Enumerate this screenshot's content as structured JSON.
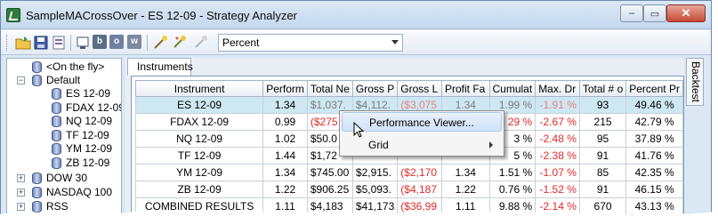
{
  "window": {
    "title": "SampleMACrossOver - ES 12-09 - Strategy Analyzer",
    "controls": {
      "minimize": "–",
      "maximize": "▭",
      "close": "✕"
    }
  },
  "toolbar": {
    "letter_buttons": [
      "b",
      "o",
      "w"
    ],
    "dropdown_value": "Percent"
  },
  "tree": {
    "items": [
      {
        "label": "<On the fly>",
        "level": 1,
        "expander": ""
      },
      {
        "label": "Default",
        "level": 0,
        "expander": "−"
      },
      {
        "label": "ES 12-09",
        "level": 1,
        "expander": ""
      },
      {
        "label": "FDAX 12-09",
        "level": 1,
        "expander": ""
      },
      {
        "label": "NQ 12-09",
        "level": 1,
        "expander": ""
      },
      {
        "label": "TF 12-09",
        "level": 1,
        "expander": ""
      },
      {
        "label": "YM 12-09",
        "level": 1,
        "expander": ""
      },
      {
        "label": "ZB 12-09",
        "level": 1,
        "expander": ""
      },
      {
        "label": "DOW 30",
        "level": 0,
        "expander": "+"
      },
      {
        "label": "NASDAQ 100",
        "level": 0,
        "expander": "+"
      },
      {
        "label": "RSS",
        "level": 0,
        "expander": "+"
      }
    ]
  },
  "tabs": {
    "instruments": "Instruments",
    "backtest": "Backtest"
  },
  "grid": {
    "columns": [
      "Instrument",
      "Perform",
      "Total Ne",
      "Gross P",
      "Gross L",
      "Profit Fa",
      "Cumulat",
      "Max. Dr",
      "Total # o",
      "Percent Pr"
    ],
    "rows": [
      [
        "ES 12-09",
        "1.34",
        "$1,037.",
        "$4,112.",
        "($3,075",
        "1.34",
        "1.99 %",
        "-1.91 %",
        "93",
        "49.46 %"
      ],
      [
        "FDAX 12-09",
        "0.99",
        "($275",
        "",
        "",
        "",
        "29 %",
        "-2.67 %",
        "215",
        "42.79 %"
      ],
      [
        "NQ 12-09",
        "1.02",
        "$50.0",
        "",
        "",
        "",
        "3 %",
        "-2.48 %",
        "95",
        "37.89 %"
      ],
      [
        "TF 12-09",
        "1.44",
        "$1,72",
        "",
        "",
        "",
        "5 %",
        "-2.38 %",
        "91",
        "41.76 %"
      ],
      [
        "YM 12-09",
        "1.34",
        "$745.00",
        "$2,915.",
        "($2,170",
        "1.34",
        "1.51 %",
        "-1.07 %",
        "85",
        "42.35 %"
      ],
      [
        "ZB 12-09",
        "1.22",
        "$906.25",
        "$5,093.",
        "($4,187",
        "1.22",
        "0.76 %",
        "-1.52 %",
        "91",
        "46.15 %"
      ],
      [
        "COMBINED RESULTS",
        "1.11",
        "$4,183",
        "$41,173",
        "($36,99",
        "1.11",
        "9.88 %",
        "-2.14 %",
        "670",
        "43.13 %"
      ]
    ]
  },
  "context_menu": {
    "items": [
      {
        "label": "Performance Viewer...",
        "submenu": false
      },
      {
        "label": "Grid",
        "submenu": true
      }
    ]
  }
}
